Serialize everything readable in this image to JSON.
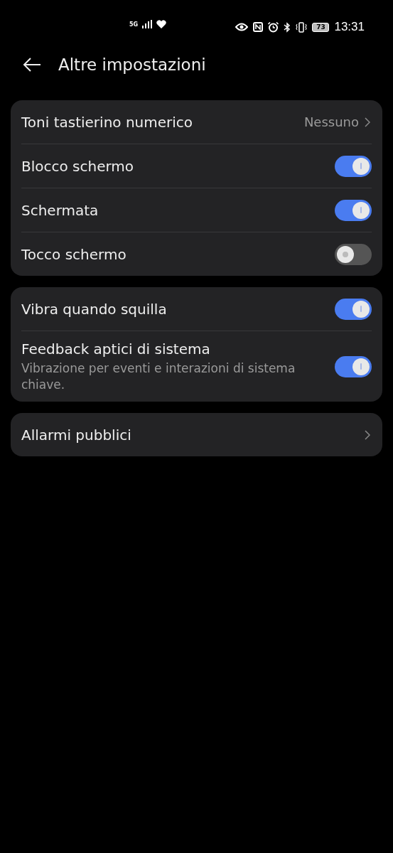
{
  "status_bar": {
    "network": "5G",
    "battery": "73",
    "time": "13:31"
  },
  "header": {
    "title": "Altre impostazioni"
  },
  "groups": [
    {
      "items": [
        {
          "kind": "value",
          "label": "Toni tastierino numerico",
          "value": "Nessuno"
        },
        {
          "kind": "toggle",
          "label": "Blocco schermo",
          "on": true
        },
        {
          "kind": "toggle",
          "label": "Schermata",
          "on": true
        },
        {
          "kind": "toggle",
          "label": "Tocco schermo",
          "on": false
        }
      ]
    },
    {
      "items": [
        {
          "kind": "toggle",
          "label": "Vibra quando squilla",
          "on": true
        },
        {
          "kind": "toggle",
          "label": "Feedback aptici di sistema",
          "subtitle": "Vibrazione per eventi e interazioni di sistema chiave.",
          "on": true
        }
      ]
    },
    {
      "items": [
        {
          "kind": "link",
          "label": "Allarmi pubblici"
        }
      ]
    }
  ]
}
